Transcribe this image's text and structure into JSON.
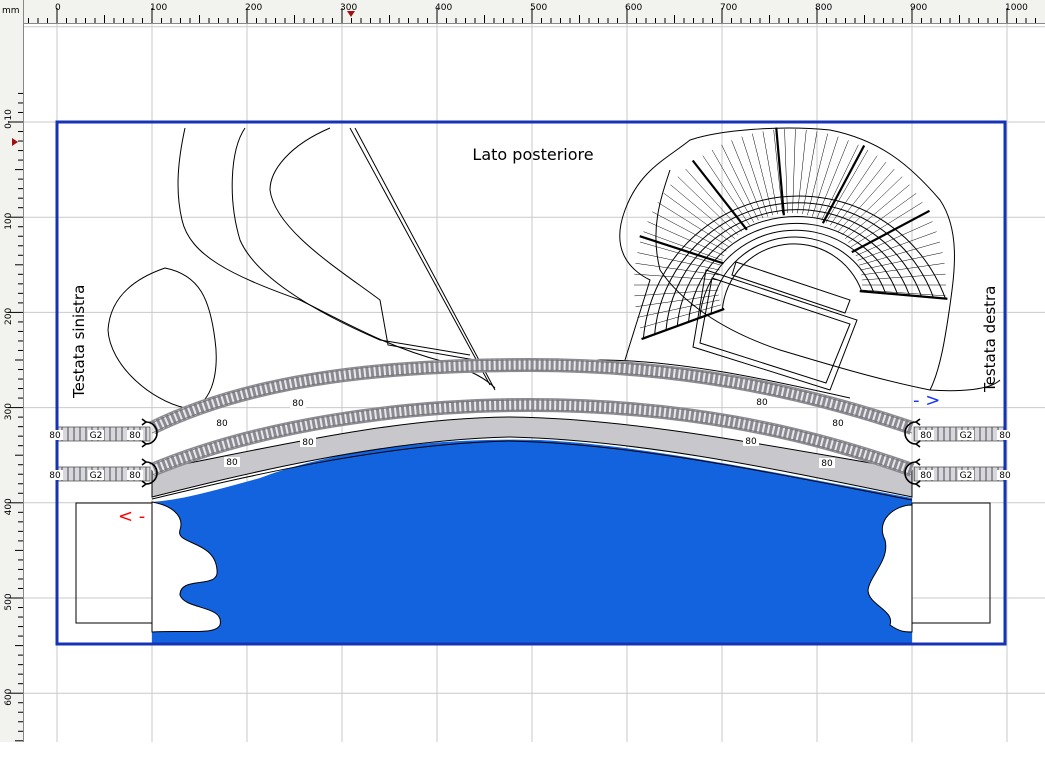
{
  "ruler": {
    "unit": "mm",
    "x_ticks": [
      "0",
      "100",
      "200",
      "300",
      "400",
      "500",
      "600",
      "700",
      "800",
      "900",
      "1000"
    ],
    "y_ticks": [
      "-10",
      "0",
      "100",
      "200",
      "300",
      "400",
      "500",
      "600"
    ]
  },
  "labels": {
    "rear_side": "Lato posteriore",
    "left_head": "Testata sinistra",
    "right_head": "Testata destra"
  },
  "direction_markers": {
    "right": "- >",
    "left": "< -"
  },
  "track": {
    "radius_label": "80",
    "piece_label": "G2"
  },
  "colors": {
    "board_outline": "#1533b5",
    "water": "#1463de",
    "direction_right": "#1533ff",
    "direction_left": "#ff0000",
    "track_bed": "#d4d4d8"
  }
}
